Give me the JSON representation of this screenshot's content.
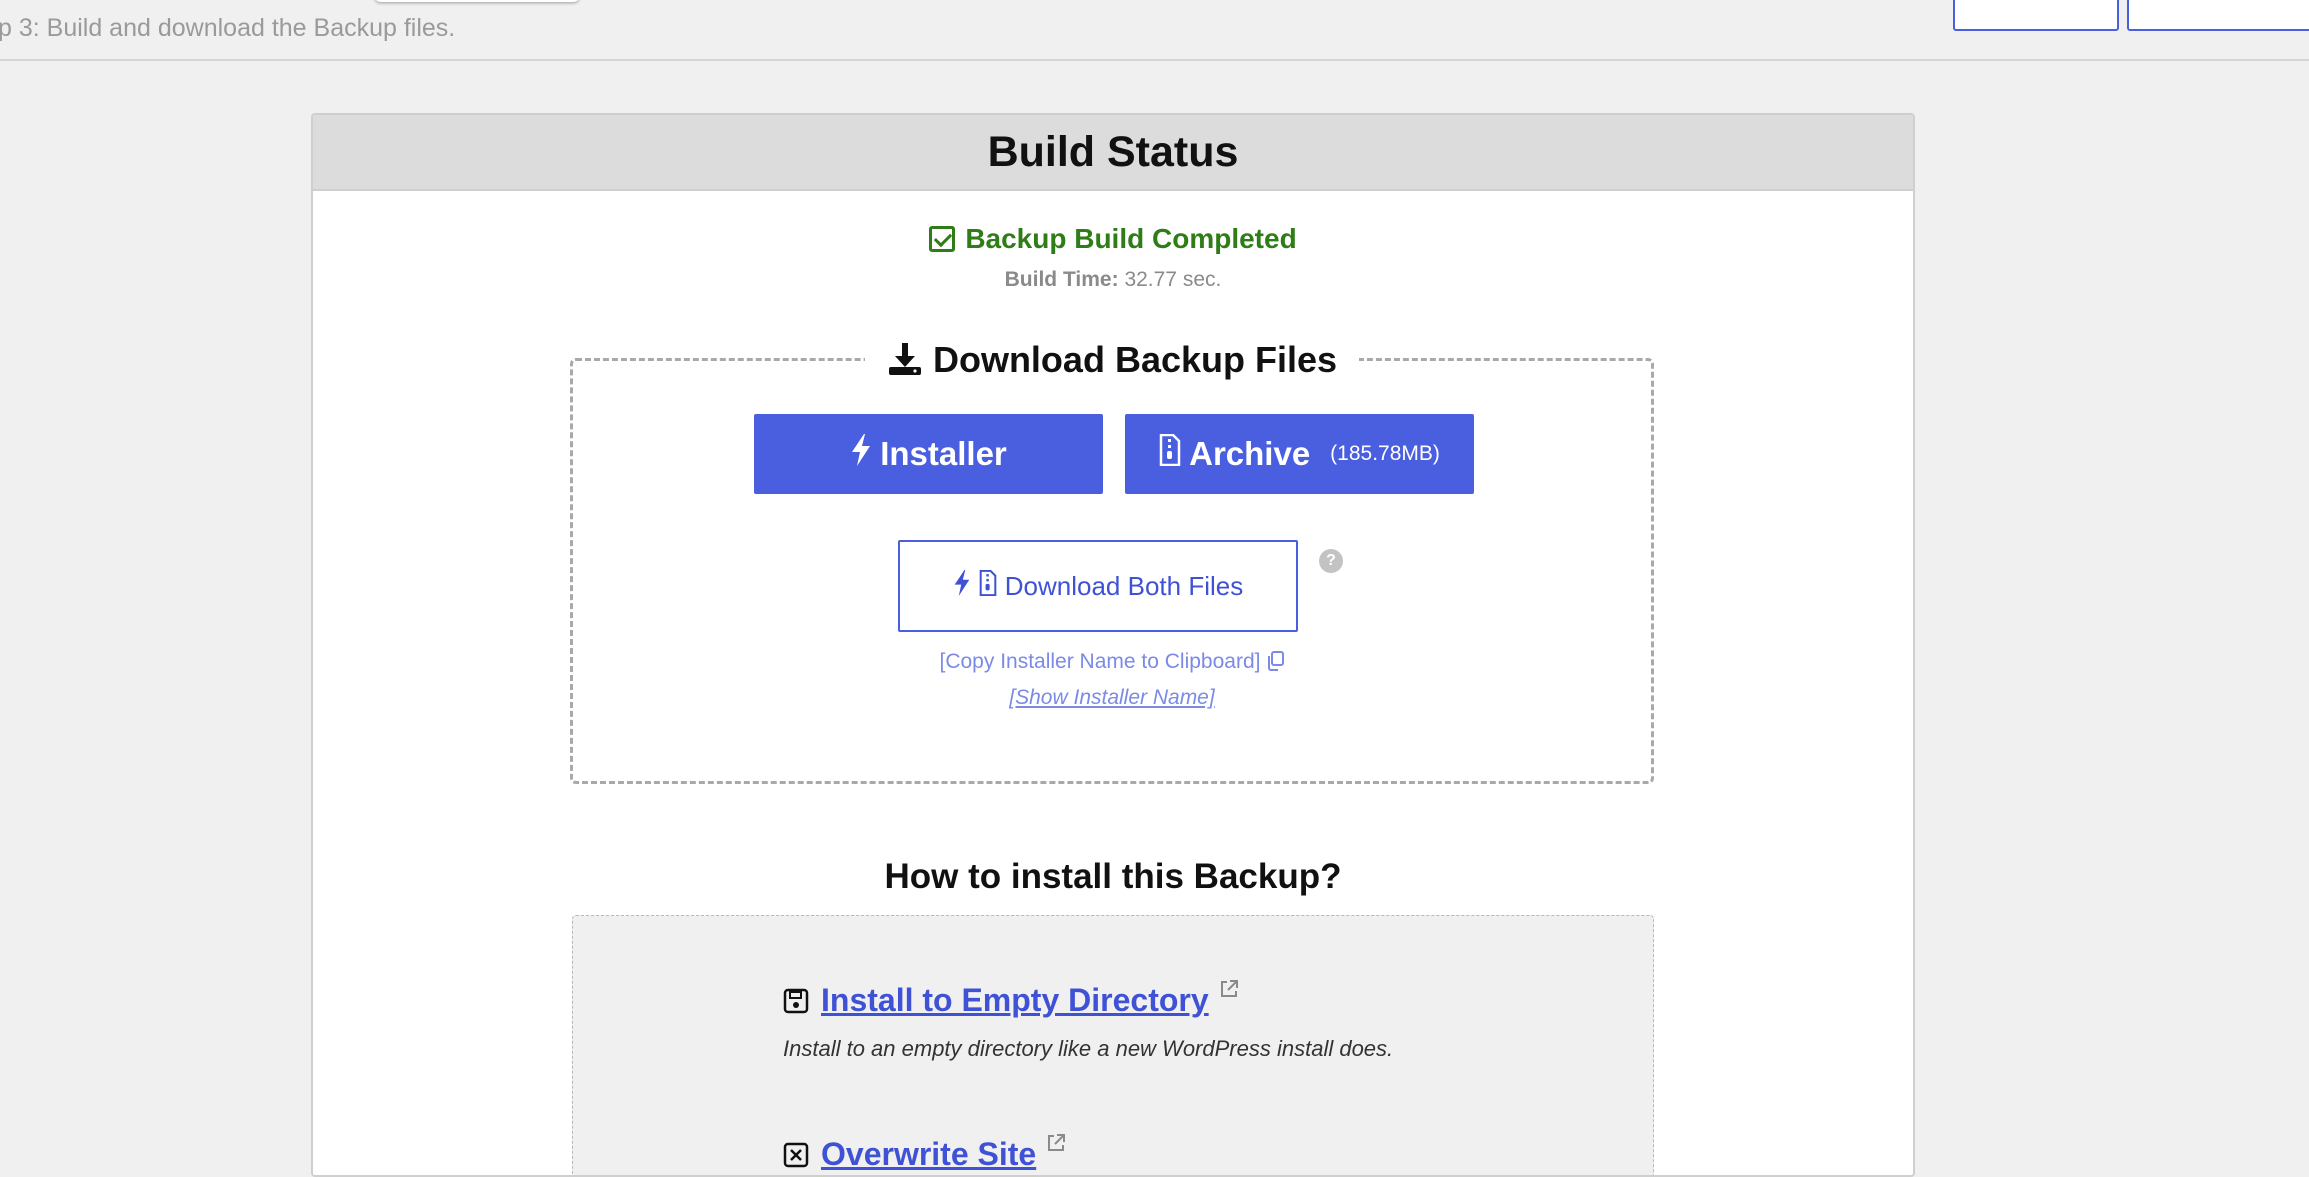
{
  "topbar": {
    "step_text": "p 3: Build and download the Backup files."
  },
  "panel": {
    "title": "Build Status"
  },
  "status": {
    "completed_text": "Backup Build Completed",
    "build_time_label": "Build Time:",
    "build_time_value": "32.77 sec."
  },
  "download": {
    "heading": "Download Backup Files",
    "installer_label": "Installer",
    "archive_label": "Archive",
    "archive_size": "(185.78MB)",
    "both_label": "Download Both Files",
    "help_glyph": "?",
    "copy_link": "[Copy Installer Name to Clipboard]",
    "show_link": "[Show Installer Name]"
  },
  "install": {
    "heading": "How to install this Backup?",
    "options": [
      {
        "title": "Install to Empty Directory",
        "description": "Install to an empty directory like a new WordPress install does.",
        "icon": "floppy-disk-icon"
      },
      {
        "title": "Overwrite Site",
        "description": "",
        "icon": "x-square-icon"
      }
    ]
  },
  "colors": {
    "accent": "#4a5ee0",
    "success": "#2f7d16",
    "link": "#3f52d6",
    "muted_link": "#7b8ae6"
  }
}
